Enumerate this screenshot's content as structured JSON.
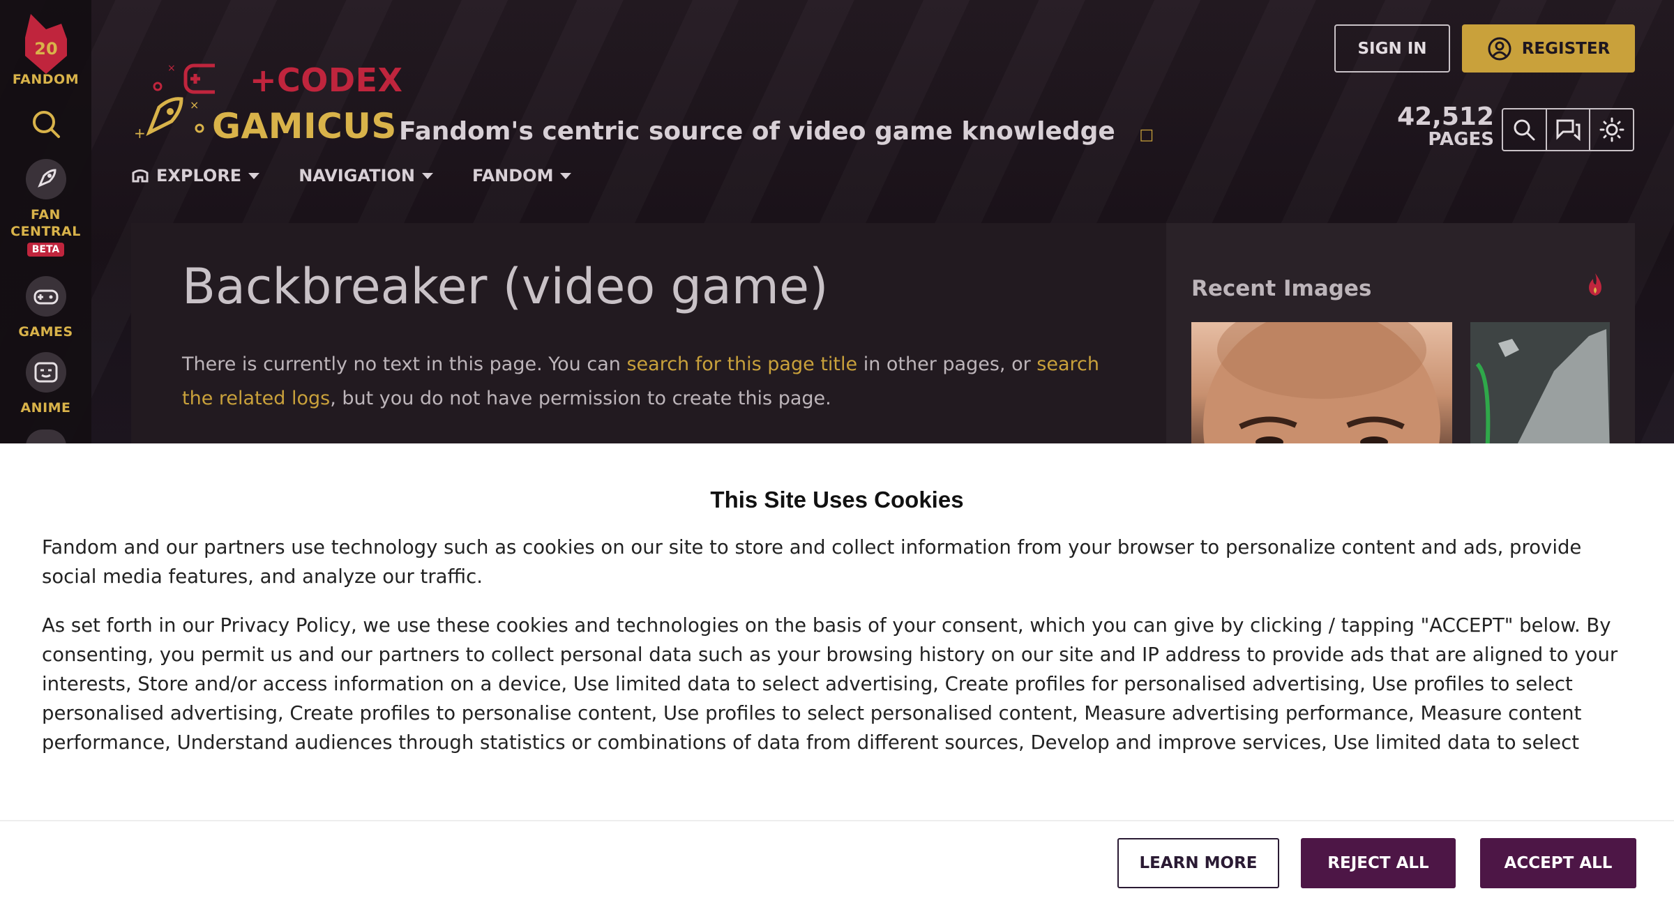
{
  "rail": {
    "fandom_label": "FANDOM",
    "fandom_badge": "20",
    "items": [
      {
        "label": "FAN CENTRAL",
        "icon": "rocket-icon",
        "badge": "BETA"
      },
      {
        "label": "GAMES",
        "icon": "controller-icon"
      },
      {
        "label": "ANIME",
        "icon": "anime-face-icon"
      }
    ]
  },
  "wiki": {
    "logo_line1": "+CODEX",
    "logo_line2": "GAMICUS",
    "tagline": "Fandom's centric source of video game knowledge",
    "nav": [
      {
        "label": "EXPLORE"
      },
      {
        "label": "NAVIGATION"
      },
      {
        "label": "FANDOM"
      }
    ],
    "pages_count": "42,512",
    "pages_label": "PAGES"
  },
  "auth": {
    "sign_in": "SIGN IN",
    "register": "REGISTER"
  },
  "article": {
    "title": "Backbreaker (video game)",
    "text_1": "There is currently no text in this page. You can ",
    "link_1": "search for this page title",
    "text_2": " in other pages, or ",
    "link_2": "search the related logs",
    "text_3": ", but you do not have permission to create this page."
  },
  "sidebar": {
    "title": "Recent Images"
  },
  "cookie": {
    "title": "This Site Uses Cookies",
    "paragraph_1": "Fandom and our partners use technology such as cookies on our site to store and collect information from your browser to personalize content and ads, provide social media features, and analyze our traffic.",
    "paragraph_2": "As set forth in our Privacy Policy, we use these cookies and technologies on the basis of your consent, which you can give by clicking / tapping \"ACCEPT\" below. By consenting, you permit us and our partners to collect personal data such as your browsing history on our site and IP address to provide ads that are aligned to your interests, Store and/or access information on a device, Use limited data to select advertising, Create profiles for personalised advertising, Use profiles to select personalised advertising, Create profiles to personalise content, Use profiles to select personalised content, Measure advertising performance, Measure content performance, Understand audiences through statistics or combinations of data from different sources, Develop and improve services, Use limited data to select content, Ensure security, prevent and detect fraud, and fix errors, Deliver and present advertising and content, Save and communicate privacy choices, Match and combine data from other data sources, Link different devices, Identify",
    "learn_more": "LEARN MORE",
    "reject_all": "REJECT ALL",
    "accept_all": "ACCEPT ALL"
  },
  "colors": {
    "accent_gold": "#c9a13b",
    "brand_red": "#c0253d",
    "cookie_button": "#4d1646"
  }
}
